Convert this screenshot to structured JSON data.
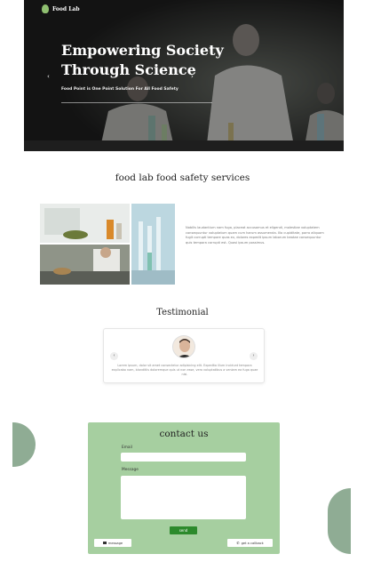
{
  "header": {
    "brand": "Food Lab"
  },
  "hero": {
    "title": "Empowering Society Through Science",
    "subtitle": "Food Point is One Point Solution For All Food Safety",
    "prev_arrow": "‹",
    "next_arrow": "›"
  },
  "services": {
    "title": "food lab food safety services",
    "text": "Nobilis laudantium nam fuga, placeat accusamus et eligendi, molestiae voluptatem consequuntur voluptatum quam cum harum assumenda. Illo cupiditate, porro aliquam fugit corrupti tempore quas ex, dolores expedit ipsum laborum beatae consequuntur quis tempora corrupti est. Quasi ipsum possimus."
  },
  "testimonial": {
    "title": "Testimonial",
    "text": "Lorem ipsum, dolor sit amet consectetur adipisicing elit. Expedita illum incidunt tempora explicabo nam, blanditiis doloremque quis ut non esse, vero voluptatibus a veniam ea fuga quae nisi.",
    "prev_arrow": "‹",
    "next_arrow": "›"
  },
  "contact": {
    "title": "contact us",
    "email_label": "Email",
    "message_label": "Message",
    "send_label": "send",
    "message_button": "message",
    "callback_button": "get a callback"
  },
  "colors": {
    "accent_green": "#2c8a2c",
    "panel_green": "#a6cfa0",
    "blob_green": "#8fac94"
  }
}
